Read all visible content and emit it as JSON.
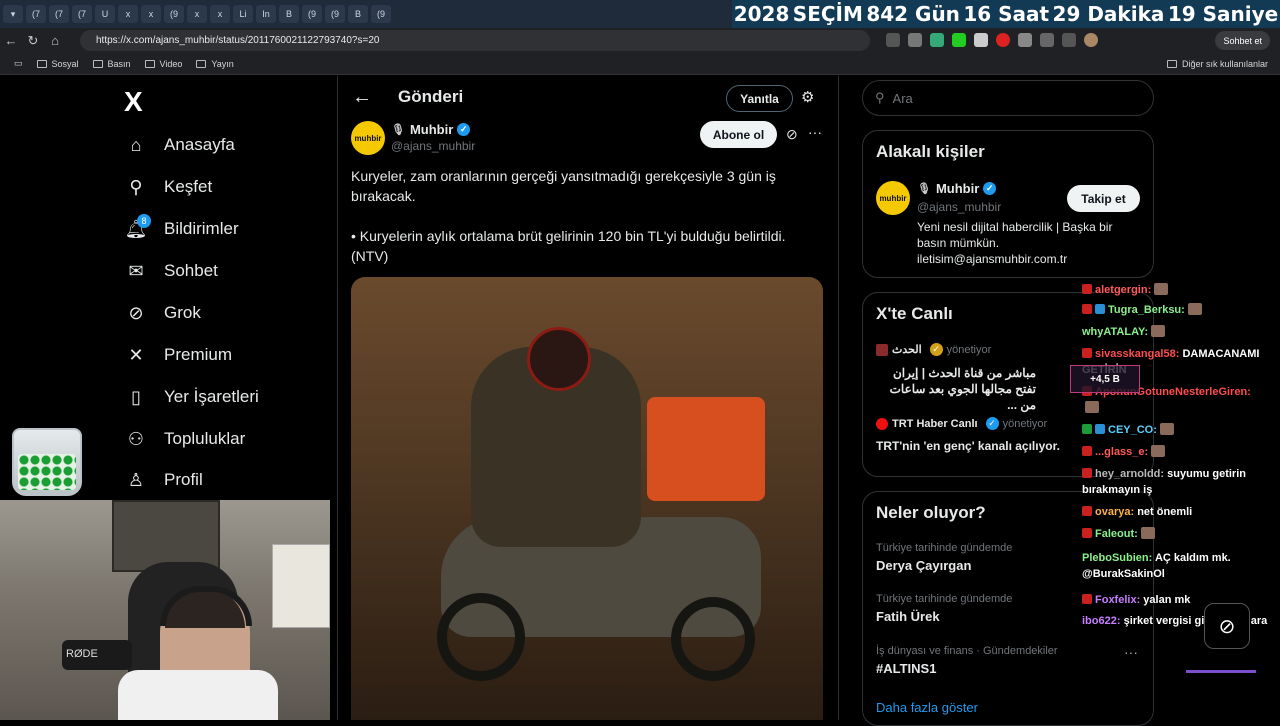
{
  "browser": {
    "tabs": [
      "(7",
      "(7",
      "(7",
      "U",
      "x",
      "x",
      "(9",
      "x",
      "x",
      "Li",
      "In",
      "B",
      "(9",
      "(9",
      "B",
      "(9"
    ],
    "url": "https://x.com/ajans_muhbir/status/2011760021122793740?s=20",
    "chat_button": "Sohbet et",
    "bookmarks": [
      "Sosyal",
      "Basın",
      "Video",
      "Yayın"
    ],
    "bookmarks_other": "Diğer sık kullanılanlar"
  },
  "countdown": {
    "year": "2028",
    "label": "SEÇİM",
    "days": "842 Gün",
    "hours": "16 Saat",
    "minutes": "29 Dakika",
    "seconds": "19 Saniye"
  },
  "sidebar": {
    "logo": "X",
    "notifications_badge": "8",
    "items": [
      {
        "label": "Anasayfa",
        "icon": "home-icon"
      },
      {
        "label": "Keşfet",
        "icon": "search-icon"
      },
      {
        "label": "Bildirimler",
        "icon": "bell-icon"
      },
      {
        "label": "Sohbet",
        "icon": "mail-icon"
      },
      {
        "label": "Grok",
        "icon": "grok-icon"
      },
      {
        "label": "Premium",
        "icon": "x-icon"
      },
      {
        "label": "Yer İşaretleri",
        "icon": "bookmark-icon"
      },
      {
        "label": "Topluluklar",
        "icon": "people-icon"
      },
      {
        "label": "Profil",
        "icon": "person-icon"
      }
    ]
  },
  "webcam": {
    "mic_label": "RØDE"
  },
  "post": {
    "header_title": "Gönderi",
    "reply_button": "Yanıtla",
    "author": {
      "avatar_text": "muhbir",
      "name": "Muhbir",
      "handle": "@ajans_muhbir"
    },
    "subscribe_button": "Abone ol",
    "text_line1": "Kuryeler, zam oranlarının gerçeği yansıtmadığı gerekçesiyle 3 gün iş bırakacak.",
    "text_line2": "• Kuryelerin aylık ortalama brüt gelirinin 120 bin TL'yi bulduğu belirtildi. (NTV)"
  },
  "right": {
    "search_placeholder": "Ara",
    "related": {
      "title": "Alakalı kişiler",
      "name": "Muhbir",
      "handle": "@ajans_muhbir",
      "follow_button": "Takip et",
      "bio": "Yeni nesil dijital habercilik | Başka bir basın mümkün. iletisim@ajansmuhbir.com.tr"
    },
    "live": {
      "title": "X'te Canlı",
      "items": [
        {
          "host": "الحدث",
          "suffix": "yönetiyor",
          "title": "مباشر من قناة الحدث | إيران تفتح مجالها الجوي بعد ساعات من ..."
        },
        {
          "host": "TRT Haber Canlı",
          "suffix": "yönetiyor",
          "title": "TRT'nin 'en genç' kanalı açılıyor."
        }
      ]
    },
    "trends": {
      "title": "Neler oluyor?",
      "items": [
        {
          "meta": "Türkiye tarihinde gündemde",
          "name": "Derya Çayırgan"
        },
        {
          "meta": "Türkiye tarihinde gündemde",
          "name": "Fatih Ürek"
        },
        {
          "meta": "İş dünyası ve finans · Gündemdekiler",
          "name": "#ALTINS1"
        }
      ],
      "show_more": "Daha fazla göster"
    }
  },
  "chat": {
    "messages": [
      {
        "user": "aletgergin:",
        "text": "",
        "color": "#ff5b5b"
      },
      {
        "user": "Tugra_Berksu:",
        "text": "",
        "color": "#8bf08b"
      },
      {
        "user": "whyATALAY:",
        "text": "",
        "color": "#8bf08b"
      },
      {
        "user": "sivasskangal58:",
        "text": "DAMACANAMI GETİRİN",
        "color": "#ff4d4d"
      },
      {
        "user": "AponunGotuneNesterleGiren:",
        "text": "",
        "color": "#ff4d4d"
      },
      {
        "user": "CEY_CO:",
        "text": "",
        "color": "#5ad0ff"
      },
      {
        "user": "...glass_e:",
        "text": "",
        "color": "#ff5b5b"
      },
      {
        "user": "hey_arnoldd:",
        "text": "suyumu getirin bırakmayın iş",
        "color": "#b9b9b9"
      },
      {
        "user": "ovarya:",
        "text": "net önemli",
        "color": "#ffb347"
      },
      {
        "user": "Faleout:",
        "text": "",
        "color": "#8bf08b"
      },
      {
        "user": "PleboSubien:",
        "text": "AÇ kaldım mk. @BurakSakinOl",
        "color": "#8bf08b"
      },
      {
        "user": "Foxfelix:",
        "text": "yalan mk",
        "color": "#c77dff"
      },
      {
        "user": "ibo622:",
        "text": "şirket vergisi giriyo bunlara",
        "color": "#c77dff"
      }
    ],
    "donation": "+4,5 B"
  }
}
